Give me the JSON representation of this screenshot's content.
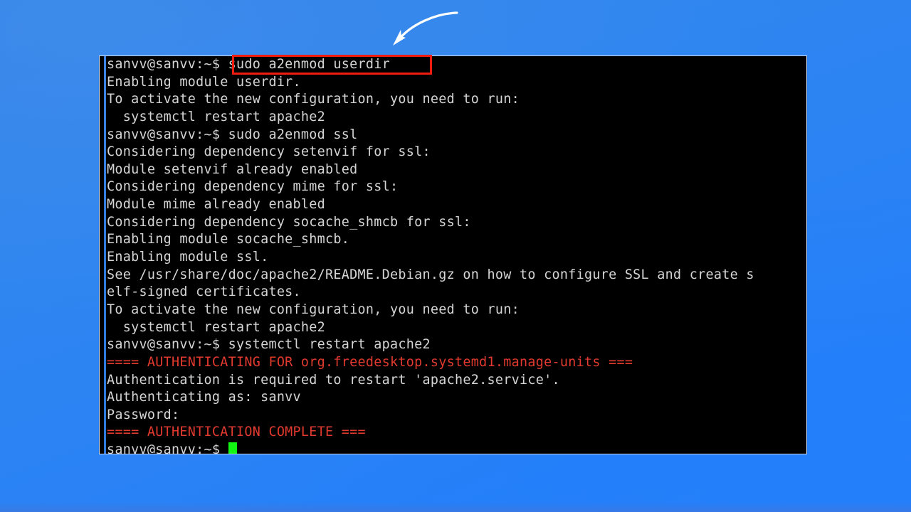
{
  "window": {
    "kind": "gnome-terminal",
    "background_color": "#000000",
    "foreground_color": "#d5d5d5",
    "error_color": "#e23a2e",
    "cursor_color": "#12f712",
    "rail_color": "#3f84e6"
  },
  "desktop": {
    "background_gradient_from": "#3287e8",
    "background_gradient_to": "#2680f8"
  },
  "annotations": {
    "arrow": {
      "name": "curved-arrow-pointing-to-command",
      "color": "#ffffff"
    },
    "highlight_box": {
      "name": "red-rectangle-around-command",
      "color": "#f01c10",
      "target_text": "sudo a2enmod userdir"
    }
  },
  "terminal": {
    "prompt": "sanvv@sanvv:~$",
    "user": "sanvv",
    "host": "sanvv",
    "cwd": "~",
    "lines": [
      {
        "text": "sanvv@sanvv:~$ sudo a2enmod userdir",
        "color": "normal"
      },
      {
        "text": "Enabling module userdir.",
        "color": "normal"
      },
      {
        "text": "To activate the new configuration, you need to run:",
        "color": "normal"
      },
      {
        "text": "  systemctl restart apache2",
        "color": "normal"
      },
      {
        "text": "sanvv@sanvv:~$ sudo a2enmod ssl",
        "color": "normal"
      },
      {
        "text": "Considering dependency setenvif for ssl:",
        "color": "normal"
      },
      {
        "text": "Module setenvif already enabled",
        "color": "normal"
      },
      {
        "text": "Considering dependency mime for ssl:",
        "color": "normal"
      },
      {
        "text": "Module mime already enabled",
        "color": "normal"
      },
      {
        "text": "Considering dependency socache_shmcb for ssl:",
        "color": "normal"
      },
      {
        "text": "Enabling module socache_shmcb.",
        "color": "normal"
      },
      {
        "text": "Enabling module ssl.",
        "color": "normal"
      },
      {
        "text": "See /usr/share/doc/apache2/README.Debian.gz on how to configure SSL and create s",
        "color": "normal"
      },
      {
        "text": "elf-signed certificates.",
        "color": "normal"
      },
      {
        "text": "To activate the new configuration, you need to run:",
        "color": "normal"
      },
      {
        "text": "  systemctl restart apache2",
        "color": "normal"
      },
      {
        "text": "sanvv@sanvv:~$ systemctl restart apache2",
        "color": "normal"
      },
      {
        "text": "==== AUTHENTICATING FOR org.freedesktop.systemd1.manage-units ===",
        "color": "red"
      },
      {
        "text": "Authentication is required to restart 'apache2.service'.",
        "color": "normal"
      },
      {
        "text": "Authenticating as: sanvv",
        "color": "normal"
      },
      {
        "text": "Password:",
        "color": "normal"
      },
      {
        "text": "==== AUTHENTICATION COMPLETE ===",
        "color": "red"
      }
    ],
    "last_prompt": "sanvv@sanvv:~$ ",
    "cursor": "block"
  }
}
